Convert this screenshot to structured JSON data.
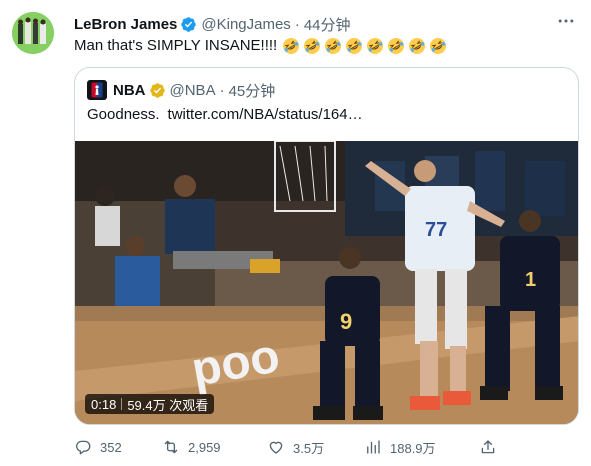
{
  "tweet": {
    "author_name": "LeBron James",
    "handle": "@KingJames",
    "separator": "·",
    "time": "44分钟",
    "text": "Man that's SIMPLY INSANE!!!!",
    "emoji_name": "rolling-on-floor-laughing",
    "emoji_count": 8
  },
  "quote": {
    "author_name": "NBA",
    "handle": "@NBA",
    "separator": "·",
    "time": "45分钟",
    "text": "Goodness.",
    "link": "twitter.com/NBA/status/164…",
    "video": {
      "duration": "0:18",
      "views": "59.4万 次观看"
    }
  },
  "actions": {
    "replies": "352",
    "retweets": "2,959",
    "likes": "3.5万",
    "views": "188.9万"
  },
  "icons": {
    "verified": "verified-badge-icon",
    "gold": "gold-verified-badge-icon",
    "more": "more-icon",
    "reply": "reply-icon",
    "retweet": "retweet-icon",
    "like": "heart-icon",
    "views": "views-icon",
    "share": "share-icon"
  },
  "colors": {
    "text": "#0f1419",
    "muted": "#536471",
    "verified_blue": "#1d9bf0",
    "verified_gold": "#e2b719",
    "border": "#cfd9de"
  }
}
